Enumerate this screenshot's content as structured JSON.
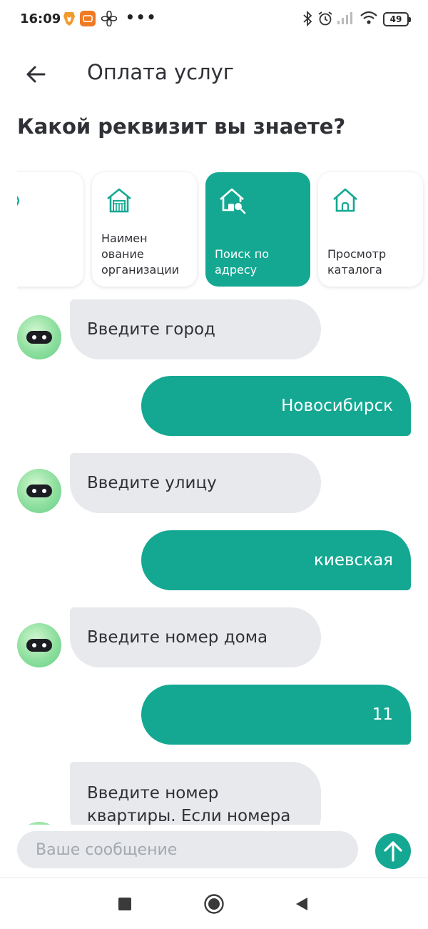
{
  "status_bar": {
    "time": "16:09",
    "dots": "•••",
    "battery": "49",
    "icons": [
      "brave-icon",
      "mi-app-icon",
      "fan-icon",
      "bluetooth-icon",
      "alarm-icon",
      "signal-icon",
      "wifi-icon",
      "battery-icon"
    ]
  },
  "header": {
    "title": "Оплата услуг",
    "back_icon": "arrow-left-icon"
  },
  "section_title": "Какой реквизит вы знаете?",
  "cards": [
    {
      "label": "",
      "icon": "partial-icon",
      "active": false
    },
    {
      "label": "Наимен ование организации",
      "icon": "house-building-icon",
      "active": false
    },
    {
      "label": "Поиск по адресу",
      "icon": "house-search-icon",
      "active": true
    },
    {
      "label": "Просмотр каталога",
      "icon": "house-icon",
      "active": false
    }
  ],
  "chat": {
    "messages": [
      {
        "from": "bot",
        "text": "Введите город"
      },
      {
        "from": "user",
        "text": "Новосибирск"
      },
      {
        "from": "bot",
        "text": "Введите улицу"
      },
      {
        "from": "user",
        "text": "киевская"
      },
      {
        "from": "bot",
        "text": "Введите номер дома"
      },
      {
        "from": "user",
        "text": "11"
      },
      {
        "from": "bot",
        "text": "Введите номер квартиры. Если номера"
      }
    ]
  },
  "input": {
    "placeholder": "Ваше сообщение",
    "value": ""
  },
  "send_icon": "arrow-up-icon",
  "nav": {
    "icons": [
      "recents-square-icon",
      "home-circle-icon",
      "back-triangle-icon"
    ]
  },
  "colors": {
    "accent": "#14a892",
    "bot_bubble": "#e7e9ec",
    "text": "#2f3136",
    "placeholder": "#a4a9b0"
  }
}
